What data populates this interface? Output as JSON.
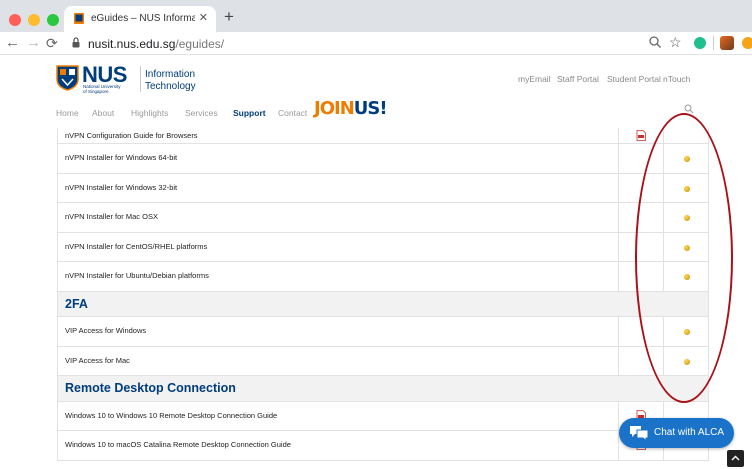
{
  "browser": {
    "tab_title": "eGuides – NUS Information Tec",
    "url_host": "nusit.nus.edu.sg",
    "url_path": "/eguides/"
  },
  "site": {
    "logo_word": "NUS",
    "logo_sub1": "National University",
    "logo_sub2": "of Singapore",
    "dept_line1": "Information",
    "dept_line2": "Technology",
    "top_links": [
      "myEmail",
      "Staff Portal",
      "Student Portal",
      "nTouch"
    ],
    "menu": [
      "Home",
      "About",
      "Highlights",
      "Services",
      "Support",
      "Contact"
    ],
    "join_us": {
      "part1": "JO",
      "part2": "IN",
      "part3": "US!"
    }
  },
  "table": {
    "rows_vpn": [
      "nVPN Configuration Guide for Browsers",
      "nVPN Installer for Windows 64-bit",
      "nVPN Installer for Windows 32-bit",
      "nVPN Installer for Mac OSX",
      "nVPN Installer for CentOS/RHEL platforms",
      "nVPN Installer for Ubuntu/Debian platforms"
    ],
    "section_2fa": "2FA",
    "rows_2fa": [
      "VIP Access for Windows",
      "VIP Access for Mac"
    ],
    "section_rdc": "Remote Desktop Connection",
    "rows_rdc": [
      "Windows 10 to Windows 10 Remote Desktop Connection Guide",
      "Windows 10 to macOS Catalina Remote Desktop Connection Guide"
    ]
  },
  "chat": {
    "label": "Chat with ALCA"
  },
  "colors": {
    "brand_blue": "#003d7c",
    "accent_orange": "#ef7c00",
    "annotation_red": "#a8131a",
    "chat_blue": "#1a73c9"
  }
}
